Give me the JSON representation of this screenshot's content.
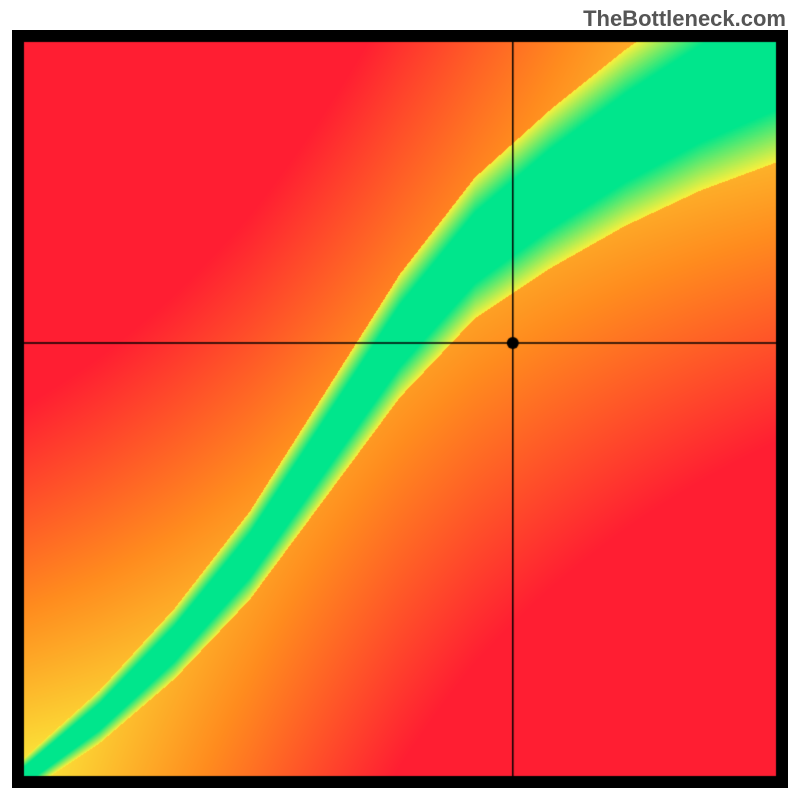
{
  "watermark": "TheBottleneck.com",
  "chart_data": {
    "type": "heatmap",
    "title": "",
    "xlabel": "",
    "ylabel": "",
    "xlim": [
      0,
      100
    ],
    "ylim": [
      0,
      100
    ],
    "crosshair": {
      "x": 65,
      "y": 59
    },
    "optimal_curve": [
      {
        "x": 0,
        "y": 0
      },
      {
        "x": 10,
        "y": 8
      },
      {
        "x": 20,
        "y": 18
      },
      {
        "x": 30,
        "y": 30
      },
      {
        "x": 40,
        "y": 45
      },
      {
        "x": 50,
        "y": 60
      },
      {
        "x": 60,
        "y": 72
      },
      {
        "x": 70,
        "y": 80
      },
      {
        "x": 80,
        "y": 87
      },
      {
        "x": 90,
        "y": 93
      },
      {
        "x": 100,
        "y": 98
      }
    ],
    "colorscale_description": "green along optimal curve, yellow near it, gradient to red in top-left and bottom-right corners, yellow in top-right and near bottom-left",
    "marker": {
      "x": 65,
      "y": 59,
      "color": "#000000"
    }
  }
}
